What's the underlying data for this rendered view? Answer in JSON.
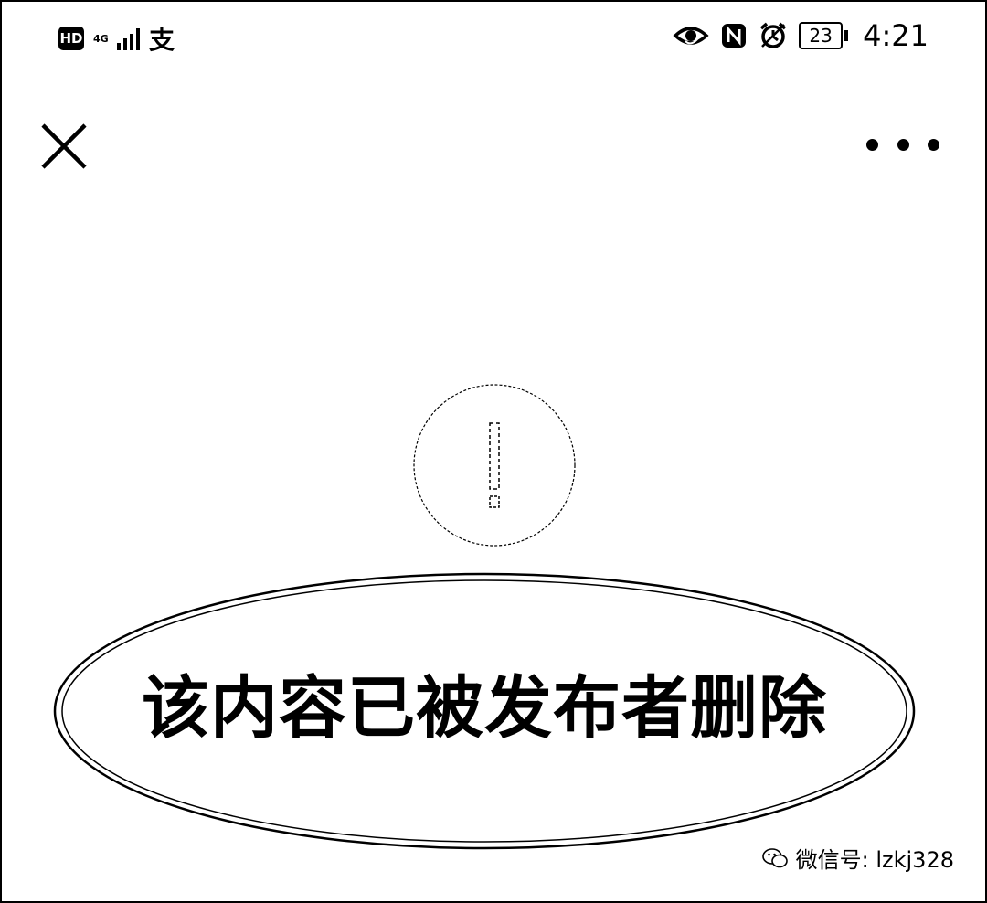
{
  "status_bar": {
    "hd_label": "HD",
    "network_type": "4G",
    "alipay_glyph": "支",
    "battery_level": "23",
    "time": "4:21",
    "icons": [
      "signal-icon",
      "eye-comfort-icon",
      "nfc-icon",
      "alarm-icon",
      "battery-icon"
    ]
  },
  "header": {
    "close_icon": "close-icon",
    "more_icon": "more-options-icon"
  },
  "main": {
    "warning_icon": "exclamation-circle-icon",
    "message": "该内容已被发布者删除"
  },
  "watermark": {
    "icon": "wechat-icon",
    "text": "微信号: lzkj328"
  }
}
